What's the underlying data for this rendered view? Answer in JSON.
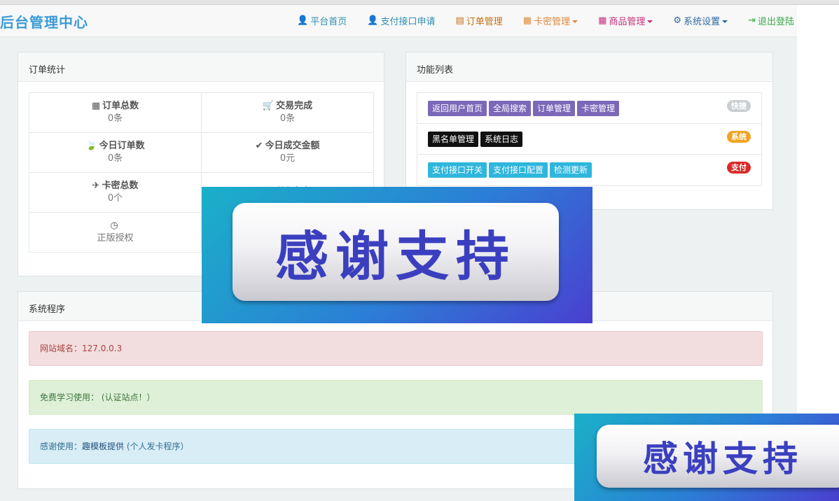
{
  "brand": "后台管理中心",
  "nav": [
    {
      "label": "平台首页",
      "icon": "user-icon",
      "glyph": "👤",
      "color": "#2f8fb0",
      "caret": false
    },
    {
      "label": "支付接口申请",
      "icon": "user-icon",
      "glyph": "👤",
      "color": "#2f8fb0",
      "caret": false
    },
    {
      "label": "订单管理",
      "icon": "list-icon",
      "glyph": "▤",
      "color": "#c36f16",
      "caret": false
    },
    {
      "label": "卡密管理",
      "icon": "card-icon",
      "glyph": "▦",
      "color": "#e08a3c",
      "caret": true
    },
    {
      "label": "商品管理",
      "icon": "product-icon",
      "glyph": "▦",
      "color": "#c6307a",
      "caret": true
    },
    {
      "label": "系统设置",
      "icon": "gear-icon",
      "glyph": "⚙",
      "color": "#2b6aa3",
      "caret": true
    },
    {
      "label": "退出登陆",
      "icon": "logout-icon",
      "glyph": "⇥",
      "color": "#3aaa4a",
      "caret": false
    }
  ],
  "order_stats": {
    "title": "订单统计",
    "cells": [
      {
        "icon": "grid-icon",
        "glyph": "▦",
        "label": "订单总数",
        "value": "0条"
      },
      {
        "icon": "cart-icon",
        "glyph": "🛒",
        "label": "交易完成",
        "value": "0条"
      },
      {
        "icon": "leaf-icon",
        "glyph": "🍃",
        "label": "今日订单数",
        "value": "0条"
      },
      {
        "icon": "check-icon",
        "glyph": "✔",
        "label": "今日成交金额",
        "value": "0元"
      },
      {
        "icon": "plane-icon",
        "glyph": "✈",
        "label": "卡密总数",
        "value": "0个"
      },
      {
        "icon": "sun-icon",
        "glyph": "✹",
        "label": "剩余卡密",
        "value": ""
      },
      {
        "icon": "dashboard-icon",
        "glyph": "◷",
        "label": "",
        "value": "正版授权"
      },
      {
        "icon": "",
        "glyph": "",
        "label": "",
        "value": ""
      }
    ]
  },
  "func_list": {
    "title": "功能列表",
    "rows": [
      {
        "buttons": [
          "返回用户首页",
          "全局搜索",
          "订单管理",
          "卡密管理"
        ],
        "style": "p",
        "badge": "快捷",
        "badge_color": "#c9ced1"
      },
      {
        "buttons": [
          "黑名单管理",
          "系统日志"
        ],
        "style": "b",
        "badge": "系统",
        "badge_color": "#f0a420"
      },
      {
        "buttons": [
          "支付接口开关",
          "支付接口配置",
          "检测更新"
        ],
        "style": "c",
        "badge": "支付",
        "badge_color": "#d92a2a"
      }
    ]
  },
  "system": {
    "title": "系统程序",
    "domain_text": "网站域名：127.0.0.3",
    "free_text": "免费学习使用：  (认证站点！）",
    "thanks_prefix": "感谢使用：",
    "thanks_provider": "趣模板提供",
    "thanks_suffix": " (个人发卡程序）"
  },
  "overlay_banner": "感谢支持"
}
